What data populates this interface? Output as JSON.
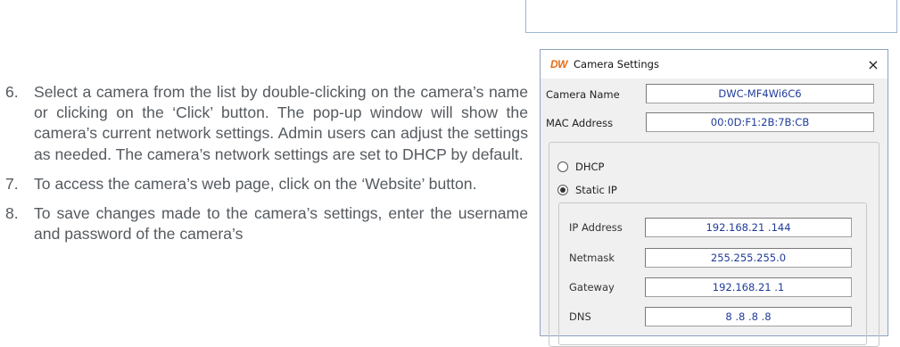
{
  "instructions": [
    {
      "num": "6.",
      "text": "Select a camera from the list by double-clicking on the camera’s name or clicking on the ‘Click’ button. The pop-up window will show the camera’s current network settings. Admin users can adjust the settings as needed. The camera’s network settings are set to DHCP by default."
    },
    {
      "num": "7.",
      "text": "To access the camera’s web page, click on the ‘Website’ button."
    },
    {
      "num": "8.",
      "text": "To save changes made to the camera’s settings, enter the username and password of the camera’s"
    }
  ],
  "dialog": {
    "logo": "DW",
    "title": "Camera Settings",
    "close": "×",
    "camera_name_label": "Camera Name",
    "camera_name_value": "DWC-MF4Wi6C6",
    "mac_label": "MAC Address",
    "mac_value": "00:0D:F1:2B:7B:CB",
    "network_mode": {
      "options": [
        "DHCP",
        "Static IP"
      ],
      "selected": "Static IP"
    },
    "ip_label": "IP Address",
    "ip_value": "192.168.21 .144",
    "netmask_label": "Netmask",
    "netmask_value": "255.255.255.0",
    "gateway_label": "Gateway",
    "gateway_value": "192.168.21 .1",
    "dns_label": "DNS",
    "dns_value": "8 .8 .8 .8"
  },
  "colors": {
    "logo_orange": "#e66a16",
    "field_text_blue": "#1f3b9a",
    "body_text": "#555a5f",
    "dialog_bg": "#f0f0f0"
  }
}
